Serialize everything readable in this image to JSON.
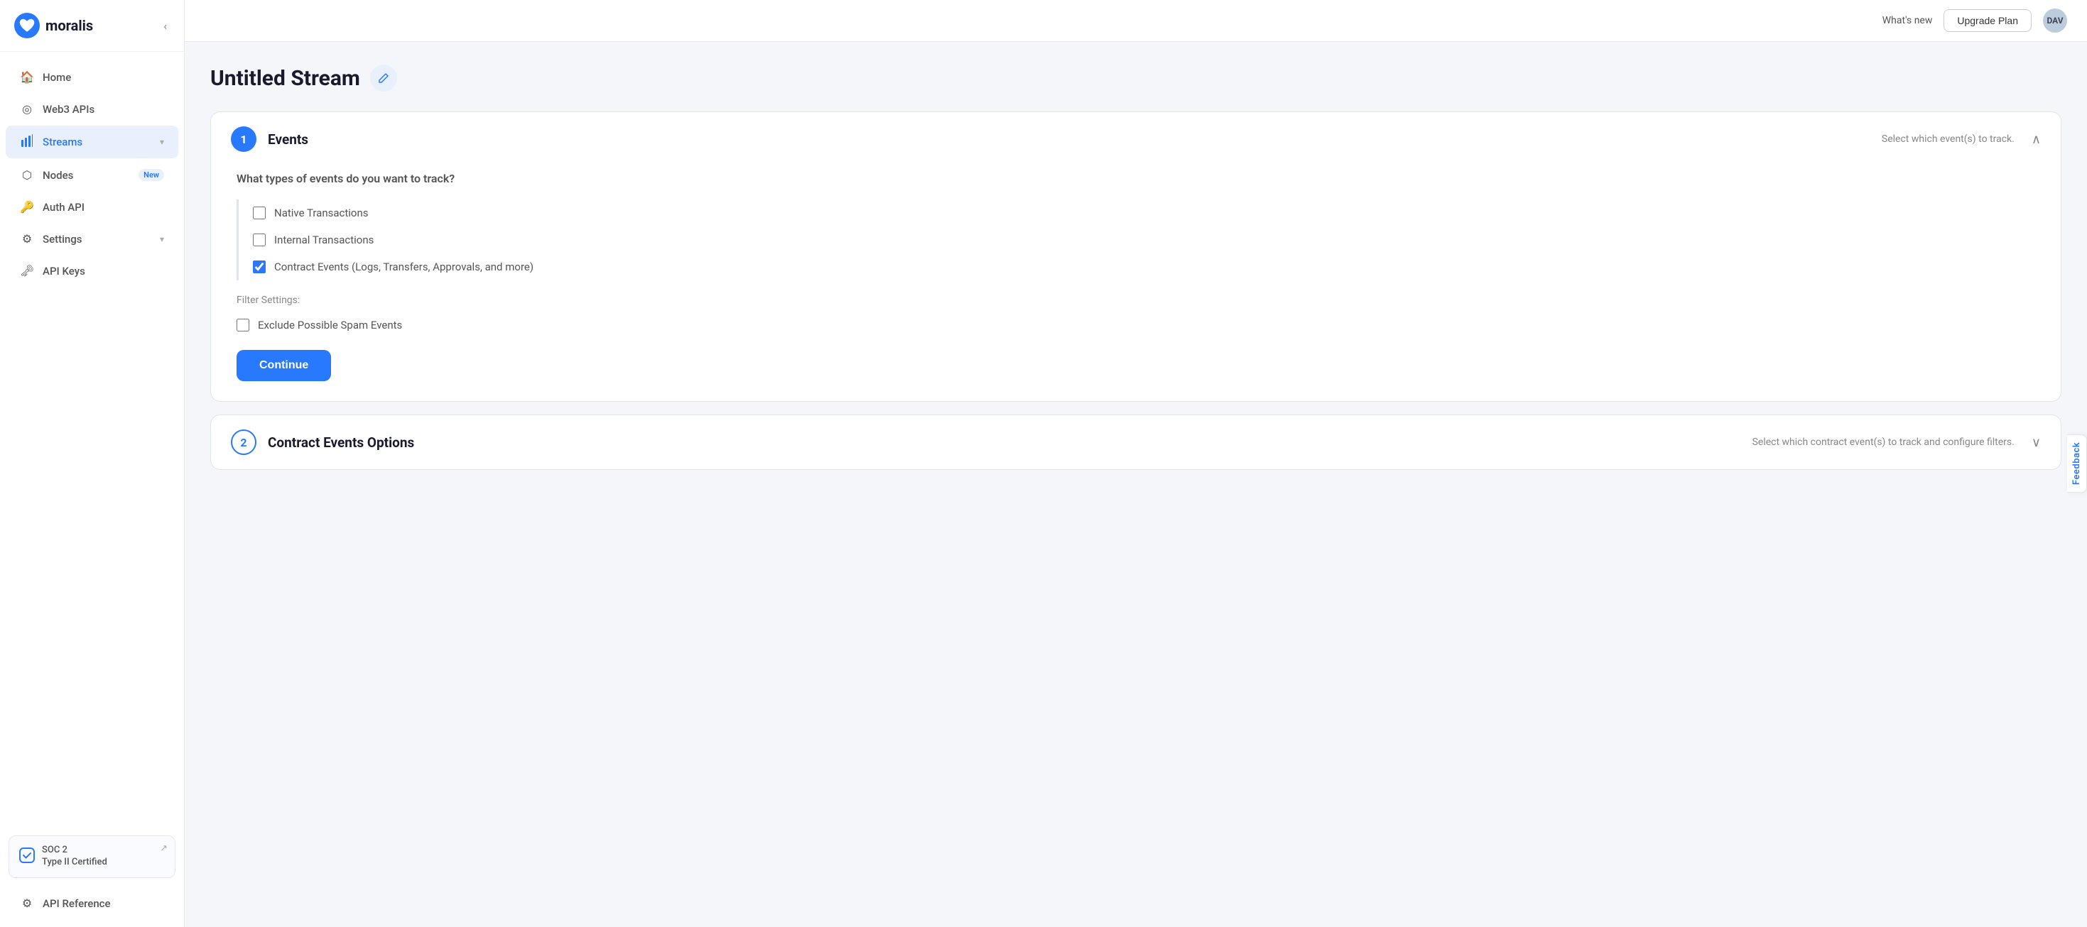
{
  "sidebar": {
    "logo": {
      "icon": "♥",
      "text": "moralis"
    },
    "nav_items": [
      {
        "id": "home",
        "icon": "⌂",
        "label": "Home",
        "active": false
      },
      {
        "id": "web3apis",
        "icon": "◎",
        "label": "Web3 APIs",
        "active": false
      },
      {
        "id": "streams",
        "icon": "≋",
        "label": "Streams",
        "active": true,
        "chevron": "▾"
      },
      {
        "id": "nodes",
        "icon": "⬡",
        "label": "Nodes",
        "active": false,
        "badge": "New"
      },
      {
        "id": "authapi",
        "icon": "🔑",
        "label": "Auth API",
        "active": false
      },
      {
        "id": "settings",
        "icon": "⚙",
        "label": "Settings",
        "active": false,
        "chevron": "▾"
      },
      {
        "id": "apikeys",
        "icon": "🗝",
        "label": "API Keys",
        "active": false
      },
      {
        "id": "apireference",
        "icon": "⚙",
        "label": "API Reference",
        "active": false
      }
    ],
    "soc2": {
      "title": "SOC 2",
      "subtitle": "Type II Certified",
      "arrow": "↗"
    }
  },
  "topbar": {
    "whats_new": "What's new",
    "upgrade_label": "Upgrade Plan",
    "avatar": "DAV"
  },
  "page": {
    "title": "Untitled Stream",
    "edit_icon": "✎",
    "sections": [
      {
        "id": "events",
        "step": "1",
        "title": "Events",
        "subtitle": "Select which event(s) to track.",
        "chevron": "∧",
        "expanded": true,
        "question": "What types of events do you want to track?",
        "checkboxes": [
          {
            "id": "native",
            "label": "Native Transactions",
            "checked": false
          },
          {
            "id": "internal",
            "label": "Internal Transactions",
            "checked": false
          },
          {
            "id": "contract",
            "label": "Contract Events (Logs, Transfers, Approvals, and more)",
            "checked": true
          }
        ],
        "filter_settings_label": "Filter Settings:",
        "filters": [
          {
            "id": "spam",
            "label": "Exclude Possible Spam Events",
            "checked": false
          }
        ],
        "continue_label": "Continue"
      },
      {
        "id": "contract-events",
        "step": "2",
        "title": "Contract Events Options",
        "subtitle": "Select which contract event(s) to track and configure filters.",
        "chevron": "∨",
        "expanded": false
      }
    ]
  },
  "feedback": {
    "label": "Feedback"
  }
}
